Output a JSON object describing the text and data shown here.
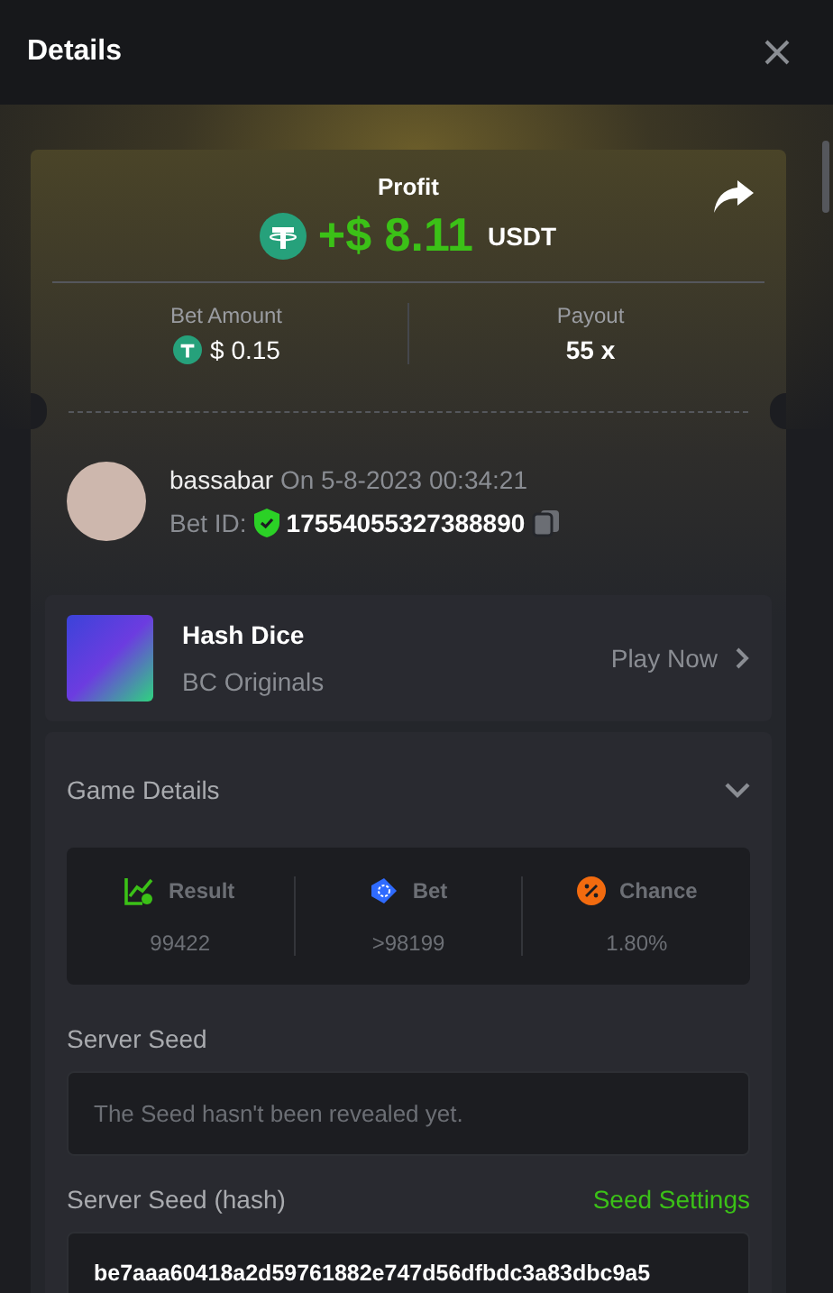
{
  "header": {
    "title": "Details"
  },
  "profit": {
    "label": "Profit",
    "amount": "+$ 8.11",
    "currency": "USDT"
  },
  "stats": [
    {
      "label": "Bet Amount",
      "value": "$ 0.15",
      "coin": true
    },
    {
      "label": "Payout",
      "value": "55 x",
      "coin": false
    }
  ],
  "player": {
    "name": "bassabar",
    "date": "On 5-8-2023 00:34:21",
    "bet_id_label": "Bet ID:",
    "bet_id": "17554055327388890"
  },
  "game": {
    "name": "Hash Dice",
    "provider": "BC Originals",
    "action": "Play Now"
  },
  "game_details": {
    "title": "Game Details",
    "expanded": true,
    "metrics": [
      {
        "kind": "result",
        "label": "Result",
        "value": "99422",
        "color": "#3bc117"
      },
      {
        "kind": "bet",
        "label": "Bet",
        "value": ">98199",
        "color": "#2f6bff"
      },
      {
        "kind": "chance",
        "label": "Chance",
        "value": "1.80%",
        "color": "#f26b0f"
      }
    ],
    "server_seed_label": "Server Seed",
    "server_seed": "The Seed hasn't been revealed yet.",
    "hash_label": "Server Seed (hash)",
    "seed_settings": "Seed Settings",
    "hash": "be7aaa60418a2d59761882e747d56dfbdc3a83dbc9a5"
  }
}
